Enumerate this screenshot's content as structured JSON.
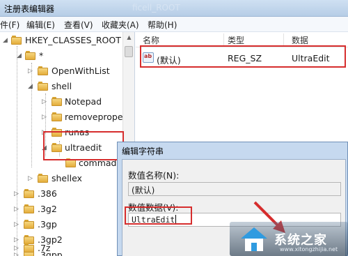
{
  "window": {
    "title": "注册表编辑器",
    "ghost_title": "ficell_ROOT"
  },
  "menu": [
    "件(F)",
    "编辑(E)",
    "查看(V)",
    "收藏夹(A)",
    "帮助(H)"
  ],
  "tree": {
    "root": "HKEY_CLASSES_ROOT",
    "items": [
      {
        "label": "*"
      },
      {
        "label": "OpenWithList"
      },
      {
        "label": "shell"
      },
      {
        "label": "Notepad"
      },
      {
        "label": "removeproper"
      },
      {
        "label": "runas"
      },
      {
        "label": "ultraedit"
      },
      {
        "label": "commad"
      },
      {
        "label": "shellex"
      },
      {
        "label": ".386"
      },
      {
        "label": ".3g2"
      },
      {
        "label": ".3gp"
      },
      {
        "label": ".3gp2"
      },
      {
        "label": ".3gpp"
      },
      {
        "label": ".7z"
      }
    ]
  },
  "list": {
    "columns": [
      "名称",
      "类型",
      "数据"
    ],
    "rows": [
      {
        "name": "(默认)",
        "type": "REG_SZ",
        "data": "UltraEdit"
      }
    ]
  },
  "dialog": {
    "title": "编辑字符串",
    "name_label": "数值名称(N):",
    "name_value": "(默认)",
    "data_label": "数值数据(V):",
    "data_value": "UltraEdit"
  },
  "watermark": {
    "text": "系统之家",
    "url": "www.xitongzhijia.net"
  },
  "colors": {
    "highlight": "#d62d2d",
    "titlebar": "#b6cde6",
    "folder": "#e4ad3a"
  }
}
